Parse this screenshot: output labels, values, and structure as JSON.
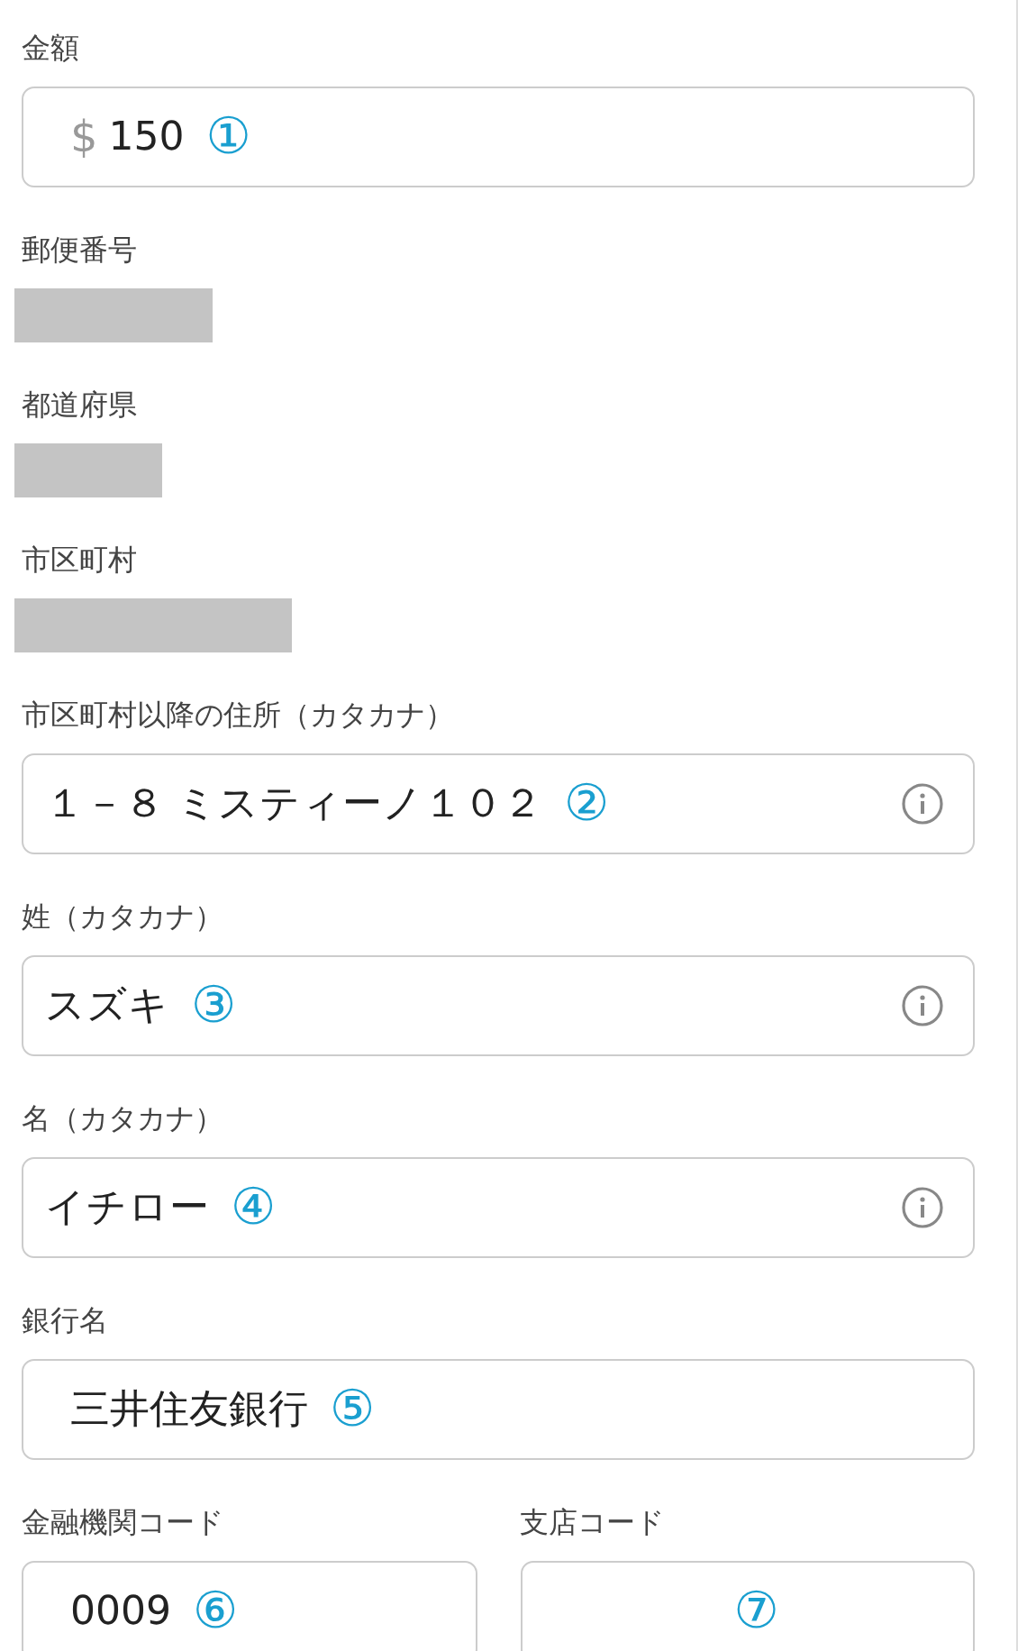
{
  "fields": [
    {
      "kind": "input",
      "label": "金額",
      "prefix": "$",
      "value": "150",
      "marker": "①"
    },
    {
      "kind": "redacted",
      "label": "郵便番号"
    },
    {
      "kind": "redacted",
      "label": "都道府県"
    },
    {
      "kind": "redacted",
      "label": "市区町村"
    },
    {
      "kind": "input",
      "label": "市区町村以降の住所（カタカナ）",
      "value": "１－８ ミスティーノ１０２",
      "marker": "②",
      "info": true
    },
    {
      "kind": "input",
      "label": "姓（カタカナ）",
      "value": "スズキ",
      "marker": "③",
      "info": true
    },
    {
      "kind": "input",
      "label": "名（カタカナ）",
      "value": "イチロー",
      "marker": "④",
      "info": true
    },
    {
      "kind": "input",
      "label": "銀行名",
      "value": "三井住友銀行",
      "marker": "⑤"
    },
    {
      "kind": "pair",
      "fields": [
        {
          "kind": "input",
          "label": "金融機関コード",
          "value": "0009",
          "marker": "⑥"
        },
        {
          "kind": "input",
          "label": "支店コード",
          "marker": "⑦"
        }
      ]
    }
  ]
}
